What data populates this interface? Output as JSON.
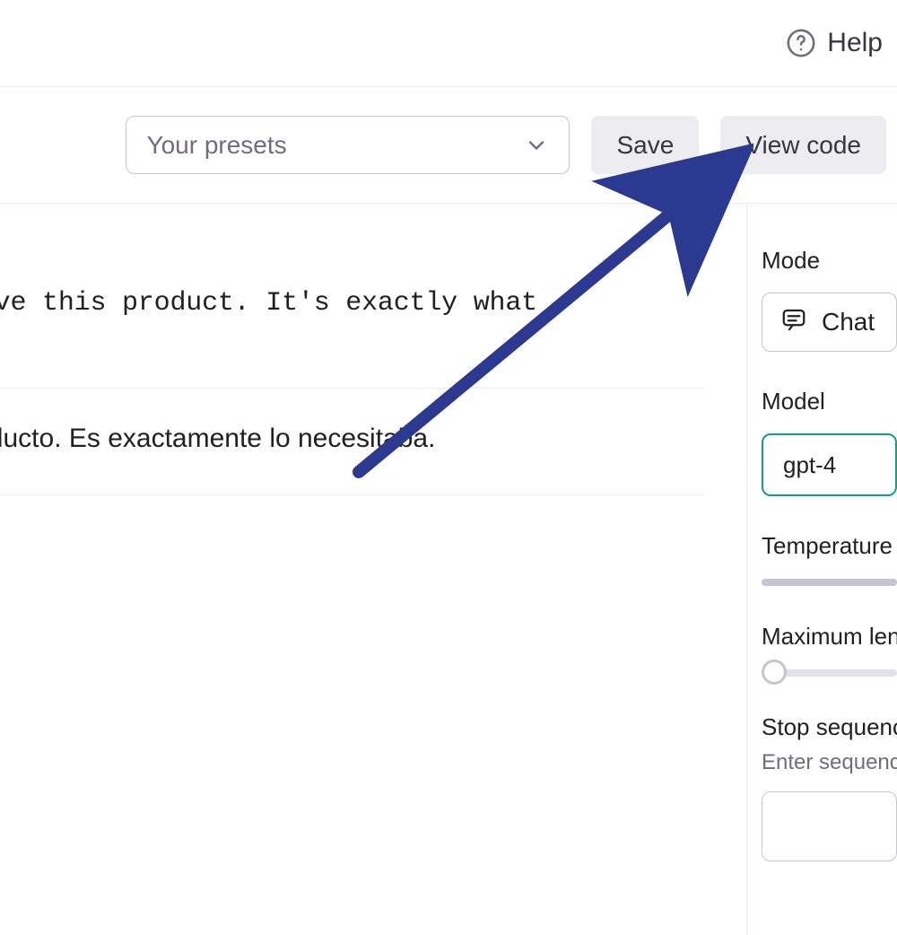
{
  "header": {
    "help_label": "Help"
  },
  "toolbar": {
    "preset_placeholder": "Your presets",
    "save_label": "Save",
    "view_code_label": "View code"
  },
  "chat": {
    "user_fragment": "slate: 'I love this product. It's exactly what\needed.'",
    "assistant_fragment": "ncanta este producto. Es exactamente lo\n necesitaba."
  },
  "sidebar": {
    "mode_label": "Mode",
    "mode_value": "Chat",
    "model_label": "Model",
    "model_value": "gpt-4",
    "temperature_label": "Temperature",
    "max_length_label": "Maximum len",
    "stop_label": "Stop sequenc",
    "stop_hint": "Enter sequence"
  }
}
